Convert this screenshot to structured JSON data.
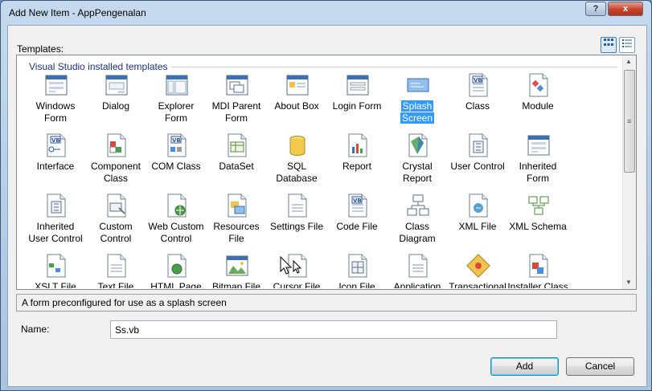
{
  "window": {
    "title": "Add New Item - AppPengenalan",
    "help": "?",
    "close": "x"
  },
  "templates_label": "Templates:",
  "view_buttons": [
    "large-icons",
    "small-icons"
  ],
  "group_header": "Visual Studio installed templates",
  "items": [
    {
      "label": "Windows\nForm",
      "icon": "form"
    },
    {
      "label": "Dialog",
      "icon": "dialog"
    },
    {
      "label": "Explorer\nForm",
      "icon": "explorer"
    },
    {
      "label": "MDI Parent\nForm",
      "icon": "mdi"
    },
    {
      "label": "About Box",
      "icon": "about"
    },
    {
      "label": "Login Form",
      "icon": "login"
    },
    {
      "label": "Splash\nScreen",
      "icon": "splash",
      "selected": true
    },
    {
      "label": "Class",
      "icon": "vbdoc"
    },
    {
      "label": "Module",
      "icon": "module"
    },
    {
      "label": "Interface",
      "icon": "interface"
    },
    {
      "label": "Component\nClass",
      "icon": "component"
    },
    {
      "label": "COM Class",
      "icon": "comclass"
    },
    {
      "label": "DataSet",
      "icon": "dataset"
    },
    {
      "label": "SQL\nDatabase",
      "icon": "database"
    },
    {
      "label": "Report",
      "icon": "report"
    },
    {
      "label": "Crystal\nReport",
      "icon": "crystal"
    },
    {
      "label": "User Control",
      "icon": "usercontrol"
    },
    {
      "label": "Inherited\nForm",
      "icon": "form"
    },
    {
      "label": "Inherited\nUser Control",
      "icon": "usercontrol"
    },
    {
      "label": "Custom\nControl",
      "icon": "custom"
    },
    {
      "label": "Web Custom\nControl",
      "icon": "webcustom"
    },
    {
      "label": "Resources\nFile",
      "icon": "resources"
    },
    {
      "label": "Settings File",
      "icon": "textdoc"
    },
    {
      "label": "Code File",
      "icon": "vbdoc"
    },
    {
      "label": "Class\nDiagram",
      "icon": "diagram"
    },
    {
      "label": "XML File",
      "icon": "xml"
    },
    {
      "label": "XML Schema",
      "icon": "schema"
    },
    {
      "label": "XSLT File",
      "icon": "xslt"
    },
    {
      "label": "Text File",
      "icon": "textdoc"
    },
    {
      "label": "HTML Page",
      "icon": "html"
    },
    {
      "label": "Bitmap File",
      "icon": "bitmap"
    },
    {
      "label": "Cursor File",
      "icon": "cursorfile"
    },
    {
      "label": "Icon File",
      "icon": "iconfile"
    },
    {
      "label": "Application",
      "icon": "textdoc"
    },
    {
      "label": "Transactional",
      "icon": "transact"
    },
    {
      "label": "Installer Class",
      "icon": "installer"
    }
  ],
  "description": "A form preconfigured for use as a splash screen",
  "name_label": "Name:",
  "name_value": "Ss.vb",
  "add_label": "Add",
  "cancel_label": "Cancel",
  "colors": {
    "selection": "#3399ff",
    "group_header": "#1e3287",
    "close_button": "#c7432a"
  }
}
